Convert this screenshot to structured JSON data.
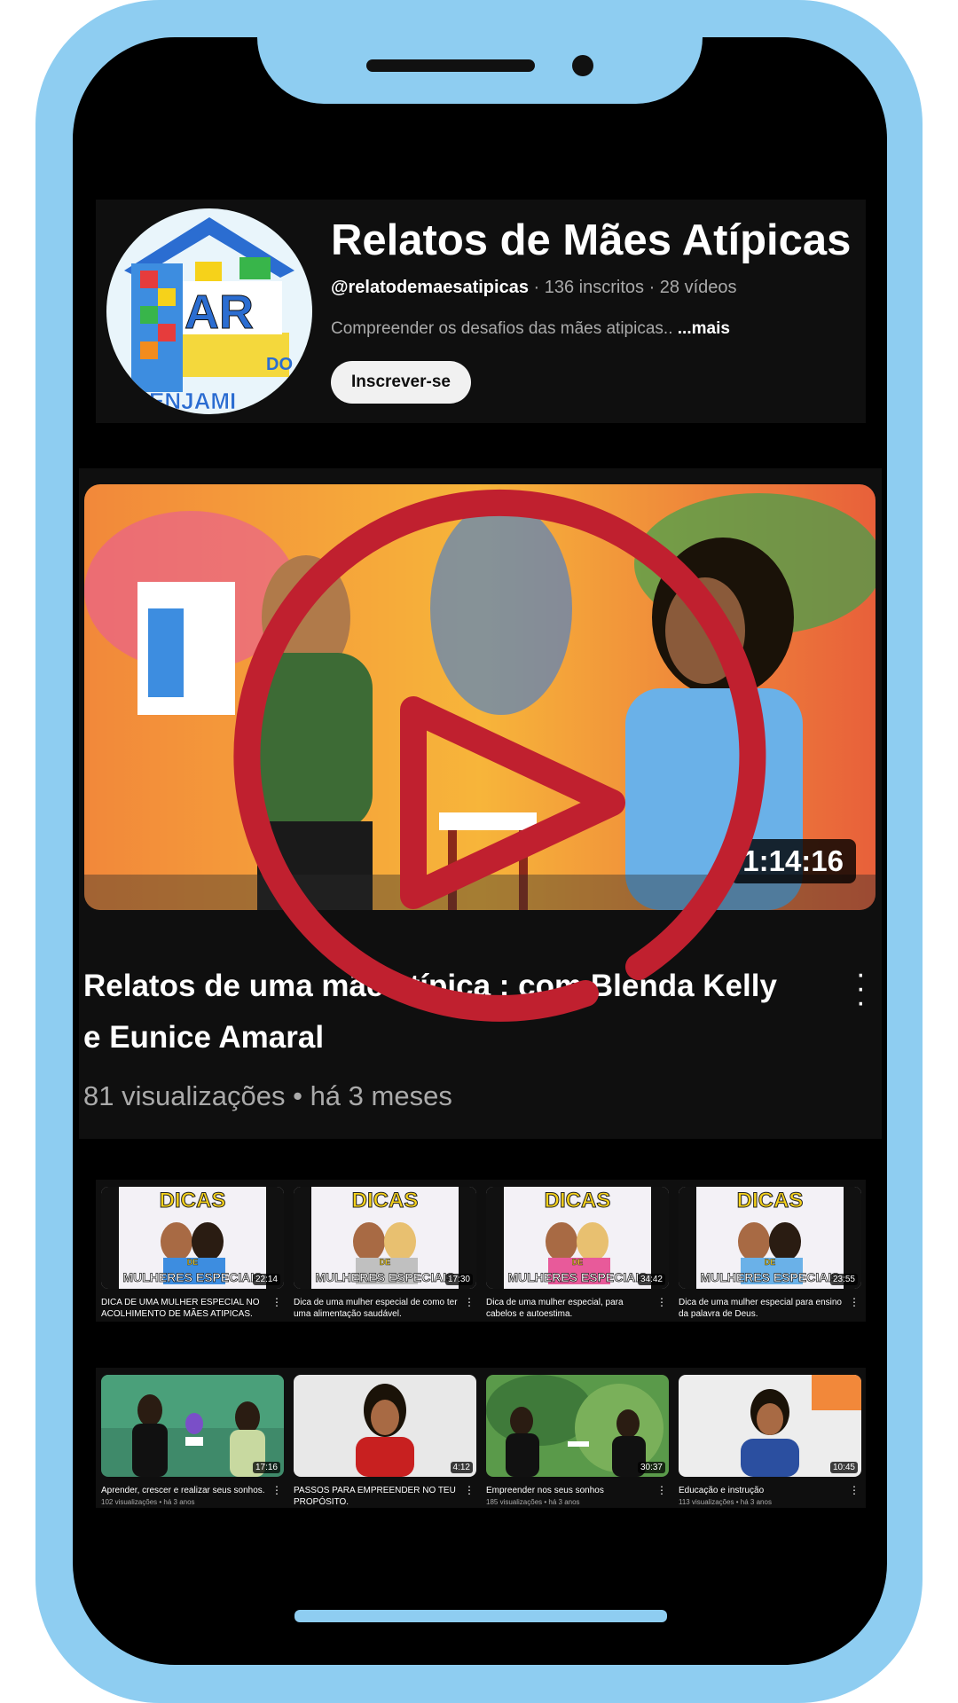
{
  "channel": {
    "name": "Relatos de Mães Atípicas",
    "handle": "@relatodemaesatipicas",
    "subscribers": "136 inscritos",
    "videos_count": "28 vídeos",
    "separator": " · ",
    "description": "Compreender os desafios das mães atipicas.. ",
    "more_label": "...mais",
    "subscribe_label": "Inscrever-se",
    "avatar_text": "LAR DO BENJAMIM"
  },
  "featured": {
    "title": "Relatos de uma mãe atípica : com Blenda Kelly e Eunice Amaral",
    "views": "81 visualizações",
    "age": "há 3 meses",
    "separator": " • ",
    "duration": "1:14:16"
  },
  "row1": [
    {
      "title": "DICA DE UMA MULHER ESPECIAL NO ACOLHIMENTO DE MÃES ATIPICAS.",
      "duration": "22:14",
      "thumb_top": "DICAS",
      "thumb_de": "DE",
      "thumb_bottom": "MULHERES ESPECIAIS"
    },
    {
      "title": "Dica de uma mulher especial de como ter uma alimentação saudável.",
      "duration": "17:30",
      "thumb_top": "DICAS",
      "thumb_de": "DE",
      "thumb_bottom": "MULHERES ESPECIAIS"
    },
    {
      "title": "Dica de uma mulher especial, para cabelos e autoestima.",
      "duration": "34:42",
      "thumb_top": "DICAS",
      "thumb_de": "DE",
      "thumb_bottom": "MULHERES ESPECIAIS"
    },
    {
      "title": "Dica de uma mulher especial para ensino da palavra de Deus.",
      "duration": "23:55",
      "thumb_top": "DICAS",
      "thumb_de": "DE",
      "thumb_bottom": "MULHERES ESPECIAIS"
    }
  ],
  "row2": [
    {
      "title": "Aprender, crescer e realizar seus sonhos.",
      "meta": "102 visualizações • há 3 anos",
      "duration": "17:16"
    },
    {
      "title": "PASSOS PARA EMPREENDER NO TEU PROPÓSITO.",
      "meta": "",
      "duration": "4:12"
    },
    {
      "title": "Empreender nos seus sonhos",
      "meta": "185 visualizações • há 3 anos",
      "duration": "30:37"
    },
    {
      "title": "Educação e instrução",
      "meta": "113 visualizações • há 3 anos",
      "duration": "10:45"
    }
  ],
  "colors": {
    "frame": "#8ecdf1",
    "screen": "#000000",
    "play_overlay": "#c0202f"
  },
  "icons": [
    "play-circle-icon",
    "more-vert-icon"
  ]
}
